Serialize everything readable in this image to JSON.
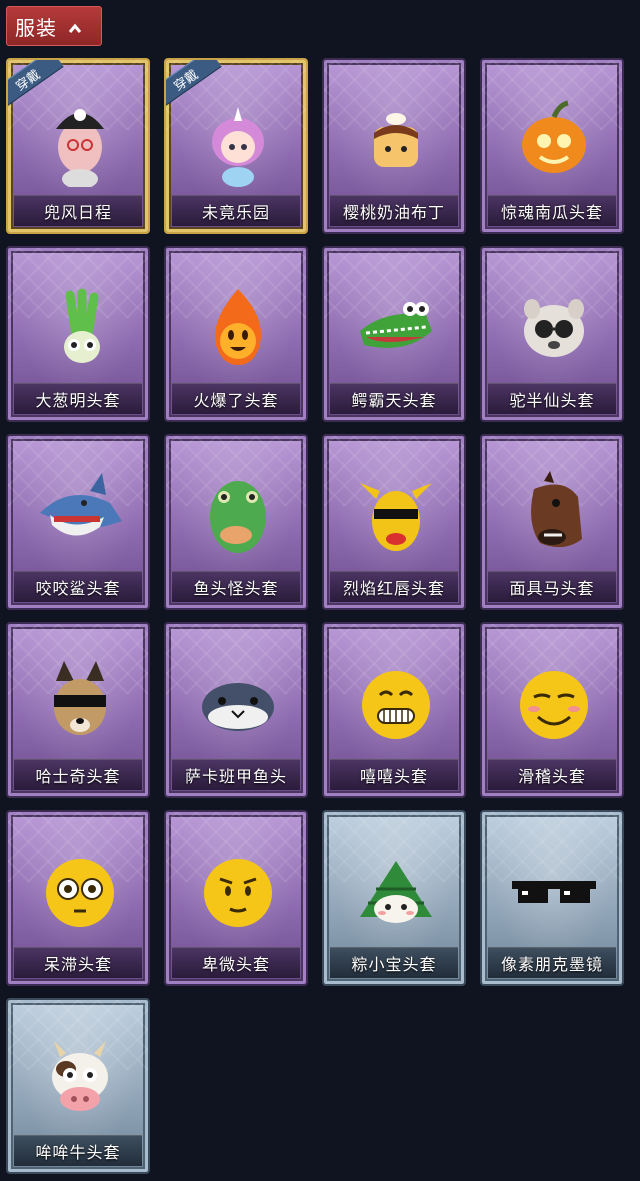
{
  "header": {
    "label": "服装",
    "expanded_icon": "chevron-up-icon"
  },
  "worn_tag": "穿戴",
  "items": [
    {
      "name": "兜风日程",
      "style": "purple",
      "worn": true,
      "icon": "pig-girl-cap-icon"
    },
    {
      "name": "未竟乐园",
      "style": "purple",
      "worn": true,
      "icon": "unicorn-girl-icon"
    },
    {
      "name": "樱桃奶油布丁",
      "style": "purple",
      "worn": false,
      "icon": "pudding-icon"
    },
    {
      "name": "惊魂南瓜头套",
      "style": "purple",
      "worn": false,
      "icon": "pumpkin-icon"
    },
    {
      "name": "大葱明头套",
      "style": "purple",
      "worn": false,
      "icon": "scallion-icon"
    },
    {
      "name": "火爆了头套",
      "style": "purple",
      "worn": false,
      "icon": "fire-icon"
    },
    {
      "name": "鳄霸天头套",
      "style": "purple",
      "worn": false,
      "icon": "crocodile-icon"
    },
    {
      "name": "驼半仙头套",
      "style": "purple",
      "worn": false,
      "icon": "alpaca-icon"
    },
    {
      "name": "咬咬鲨头套",
      "style": "purple",
      "worn": false,
      "icon": "shark-icon"
    },
    {
      "name": "鱼头怪头套",
      "style": "purple",
      "worn": false,
      "icon": "fish-head-icon"
    },
    {
      "name": "烈焰红唇头套",
      "style": "purple",
      "worn": false,
      "icon": "electric-mouse-icon"
    },
    {
      "name": "面具马头套",
      "style": "purple",
      "worn": false,
      "icon": "horse-head-icon"
    },
    {
      "name": "哈士奇头套",
      "style": "purple",
      "worn": false,
      "icon": "husky-icon"
    },
    {
      "name": "萨卡班甲鱼头",
      "style": "purple",
      "worn": false,
      "icon": "whale-fish-icon"
    },
    {
      "name": "嘻嘻头套",
      "style": "purple",
      "worn": false,
      "icon": "grin-emoji-icon"
    },
    {
      "name": "滑稽头套",
      "style": "purple",
      "worn": false,
      "icon": "funny-emoji-icon"
    },
    {
      "name": "呆滞头套",
      "style": "purple",
      "worn": false,
      "icon": "dazed-emoji-icon"
    },
    {
      "name": "卑微头套",
      "style": "purple",
      "worn": false,
      "icon": "humble-emoji-icon"
    },
    {
      "name": "粽小宝头套",
      "style": "blue",
      "worn": false,
      "icon": "zongzi-icon"
    },
    {
      "name": "像素朋克墨镜",
      "style": "blue",
      "worn": false,
      "icon": "pixel-sunglasses-icon"
    },
    {
      "name": "哞哞牛头套",
      "style": "blue",
      "worn": false,
      "icon": "cow-head-icon"
    }
  ]
}
